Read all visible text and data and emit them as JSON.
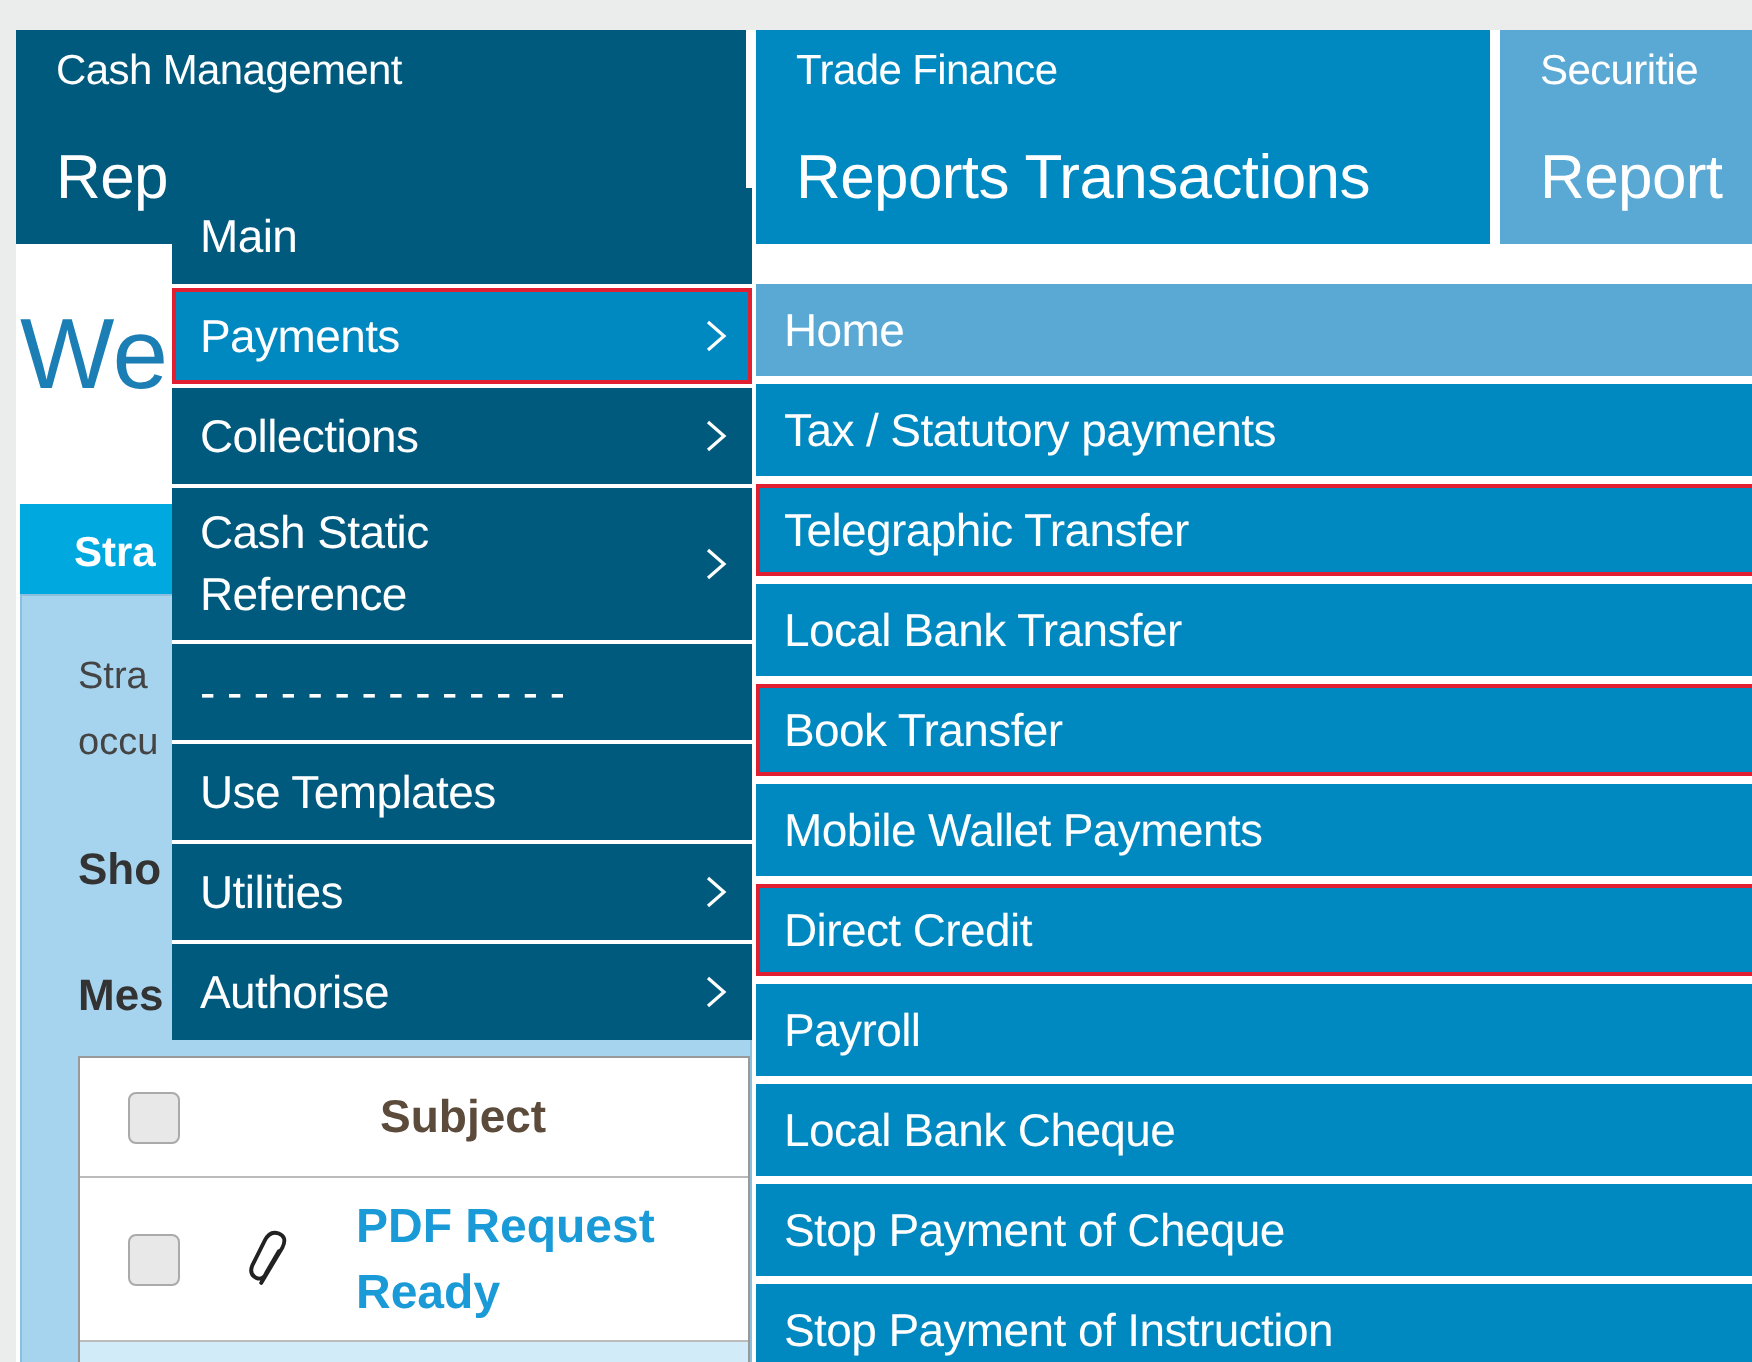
{
  "top_tabs": [
    {
      "category": "Cash Management",
      "title": "Rep",
      "color": "#005a7e"
    },
    {
      "category": "Trade Finance",
      "title": "Reports Transactions",
      "color": "#0088c0"
    },
    {
      "category": "Securitie",
      "title": "Report",
      "color": "#5aa8d4"
    }
  ],
  "heading": "We",
  "panel": {
    "tab": "Stra",
    "text_lines": [
      "Stra",
      "occu"
    ],
    "show_label": "Sho",
    "messages_label": "Mes",
    "table": {
      "header": {
        "checked": false,
        "subject": "Subject"
      },
      "rows": [
        {
          "checked": false,
          "attachment": true,
          "subject": "PDF Request Ready",
          "selected": false
        },
        {
          "selected": true
        }
      ]
    }
  },
  "menu": [
    {
      "label": "Main",
      "submenu": false,
      "selected": false,
      "highlighted": false
    },
    {
      "label": "Payments",
      "submenu": true,
      "selected": true,
      "highlighted": true
    },
    {
      "label": "Collections",
      "submenu": true,
      "selected": false,
      "highlighted": false
    },
    {
      "label": "Cash Static Reference",
      "submenu": true,
      "selected": false,
      "highlighted": false
    },
    {
      "label": "- - - - - - - - - - - - - -",
      "submenu": false,
      "selected": false,
      "highlighted": false
    },
    {
      "label": "Use Templates",
      "submenu": false,
      "selected": false,
      "highlighted": false
    },
    {
      "label": "Utilities",
      "submenu": true,
      "selected": false,
      "highlighted": false
    },
    {
      "label": "Authorise",
      "submenu": true,
      "selected": false,
      "highlighted": false
    }
  ],
  "submenu": [
    {
      "label": "Home",
      "selected": true,
      "highlighted": false
    },
    {
      "label": "Tax / Statutory payments",
      "selected": false,
      "highlighted": false
    },
    {
      "label": "Telegraphic Transfer",
      "selected": false,
      "highlighted": true
    },
    {
      "label": "Local Bank Transfer",
      "selected": false,
      "highlighted": false
    },
    {
      "label": "Book Transfer",
      "selected": false,
      "highlighted": true
    },
    {
      "label": "Mobile Wallet Payments",
      "selected": false,
      "highlighted": false
    },
    {
      "label": "Direct Credit",
      "selected": false,
      "highlighted": true
    },
    {
      "label": "Payroll",
      "selected": false,
      "highlighted": false
    },
    {
      "label": "Local Bank Cheque",
      "selected": false,
      "highlighted": false
    },
    {
      "label": "Stop Payment of Cheque",
      "selected": false,
      "highlighted": false
    },
    {
      "label": "Stop Payment of Instruction",
      "selected": false,
      "highlighted": false
    }
  ]
}
